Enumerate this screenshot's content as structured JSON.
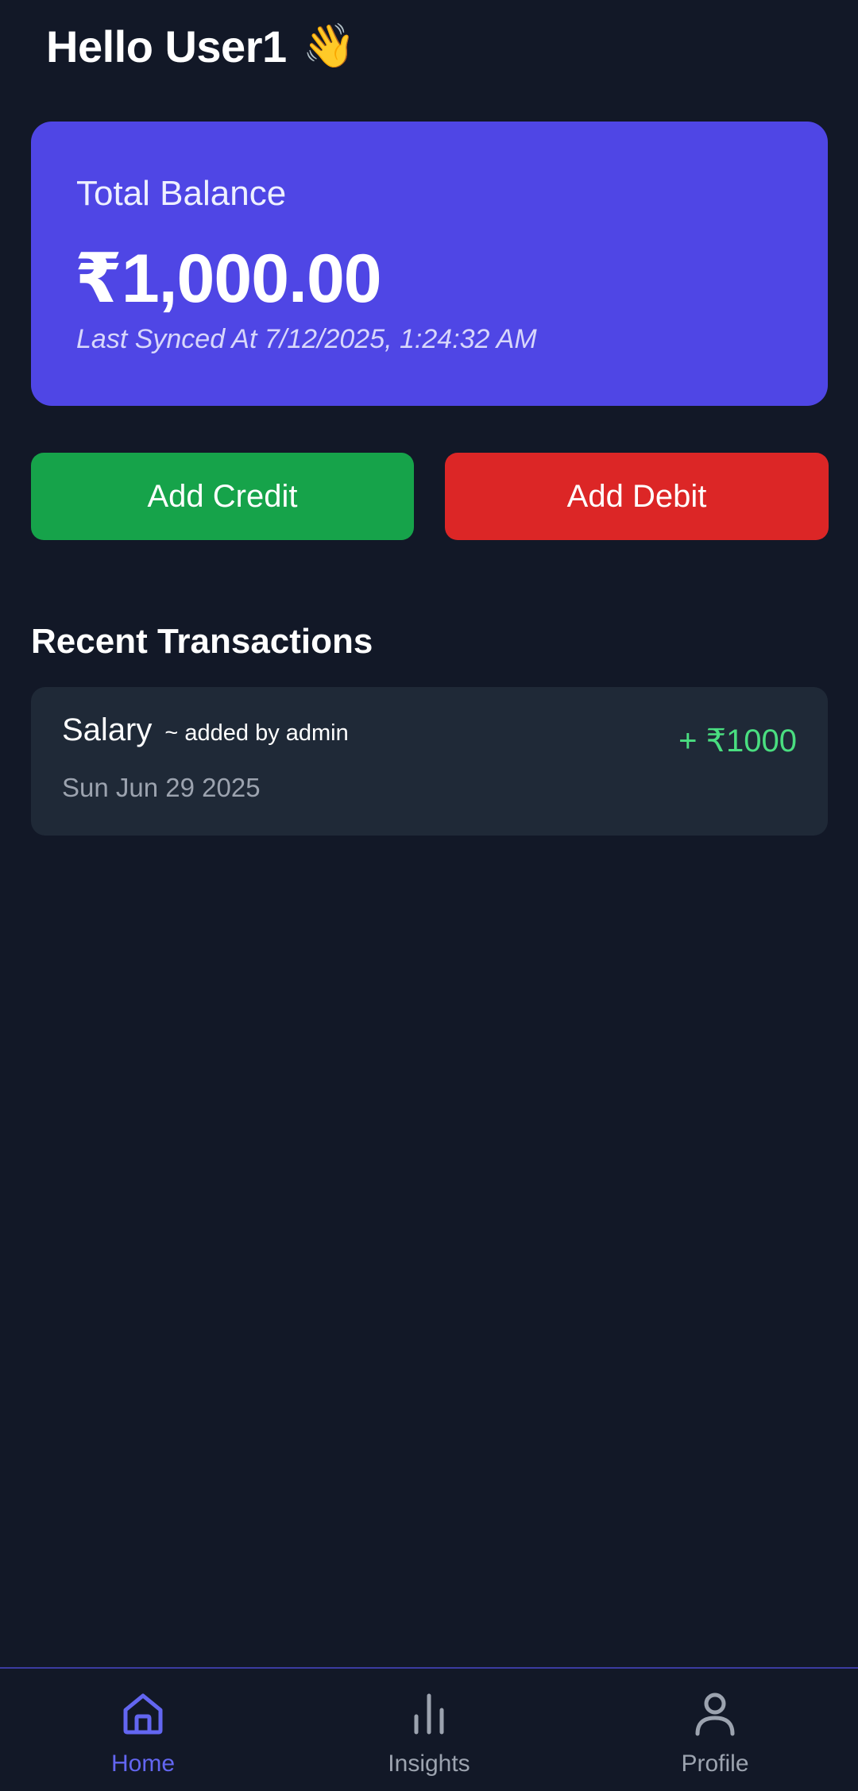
{
  "header": {
    "greeting": "Hello User1",
    "wave_emoji": "👋"
  },
  "balance": {
    "label": "Total Balance",
    "amount": "₹1,000.00",
    "last_synced": "Last Synced At 7/12/2025, 1:24:32 AM"
  },
  "actions": {
    "credit_label": "Add Credit",
    "debit_label": "Add Debit"
  },
  "transactions": {
    "title": "Recent Transactions",
    "items": [
      {
        "name": "Salary",
        "added_by": "~ added by admin",
        "date": "Sun Jun 29 2025",
        "amount": "+ ₹1000"
      }
    ]
  },
  "nav": {
    "items": [
      {
        "label": "Home",
        "icon": "home-icon",
        "active": true
      },
      {
        "label": "Insights",
        "icon": "bar-chart-icon",
        "active": false
      },
      {
        "label": "Profile",
        "icon": "user-icon",
        "active": false
      }
    ]
  },
  "colors": {
    "background": "#121827",
    "card": "#4f46e5",
    "credit": "#16a34a",
    "debit": "#dc2626",
    "positive_amount": "#4ade80",
    "nav_active": "#6366f1",
    "nav_inactive": "#9ca3af"
  }
}
